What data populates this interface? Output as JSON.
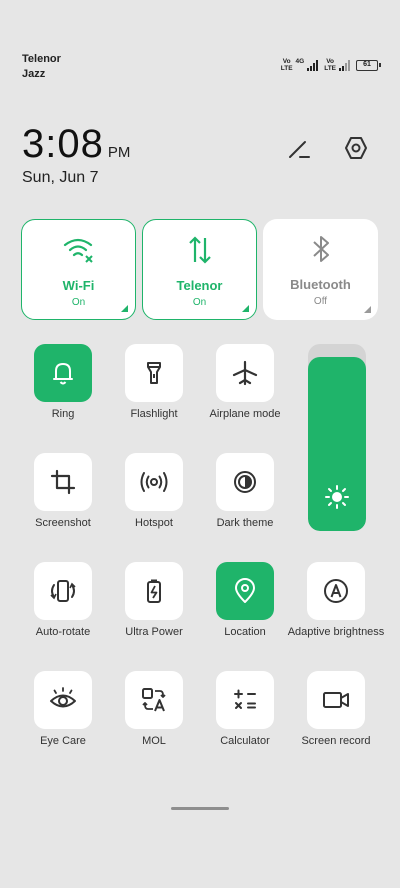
{
  "status_bar": {
    "carriers": [
      "Telenor",
      "Jazz"
    ],
    "sim1_tag": "Vo\nLTE",
    "net_tag": "4G",
    "sim2_tag": "Vo\nLTE",
    "battery": "61"
  },
  "header": {
    "time": "3:08",
    "ampm": "PM",
    "date": "Sun, Jun 7"
  },
  "big_tiles": [
    {
      "name": "Wi-Fi",
      "state": "On",
      "icon": "wifi-off-icon",
      "active": true
    },
    {
      "name": "Telenor",
      "state": "On",
      "icon": "mobile-data-icon",
      "active": true
    },
    {
      "name": "Bluetooth",
      "state": "Off",
      "icon": "bluetooth-icon",
      "active": false
    }
  ],
  "tiles": [
    {
      "label": "Ring",
      "icon": "bell-icon",
      "active": true
    },
    {
      "label": "Flashlight",
      "icon": "flashlight-icon",
      "active": false
    },
    {
      "label": "Airplane mode",
      "icon": "airplane-icon",
      "active": false
    },
    {
      "label": "Screenshot",
      "icon": "crop-icon",
      "active": false
    },
    {
      "label": "Hotspot",
      "icon": "hotspot-icon",
      "active": false
    },
    {
      "label": "Dark theme",
      "icon": "dark-theme-icon",
      "active": false
    },
    {
      "label": "Auto-rotate",
      "icon": "auto-rotate-icon",
      "active": false
    },
    {
      "label": "Ultra Power",
      "icon": "battery-bolt-icon",
      "active": false
    },
    {
      "label": "Location",
      "icon": "location-pin-icon",
      "active": true
    },
    {
      "label": "Adaptive brightness",
      "icon": "adaptive-brightness-icon",
      "active": false
    },
    {
      "label": "Eye Care",
      "icon": "eye-icon",
      "active": false
    },
    {
      "label": "MOL",
      "icon": "translate-icon",
      "active": false
    },
    {
      "label": "Calculator",
      "icon": "calculator-icon",
      "active": false
    },
    {
      "label": "Screen record",
      "icon": "video-camera-icon",
      "active": false
    }
  ],
  "brightness": {
    "level": 0.93,
    "icon": "sun-icon"
  },
  "colors": {
    "accent": "#1fb46a",
    "background": "#e6e6e6",
    "tile": "#ffffff"
  }
}
